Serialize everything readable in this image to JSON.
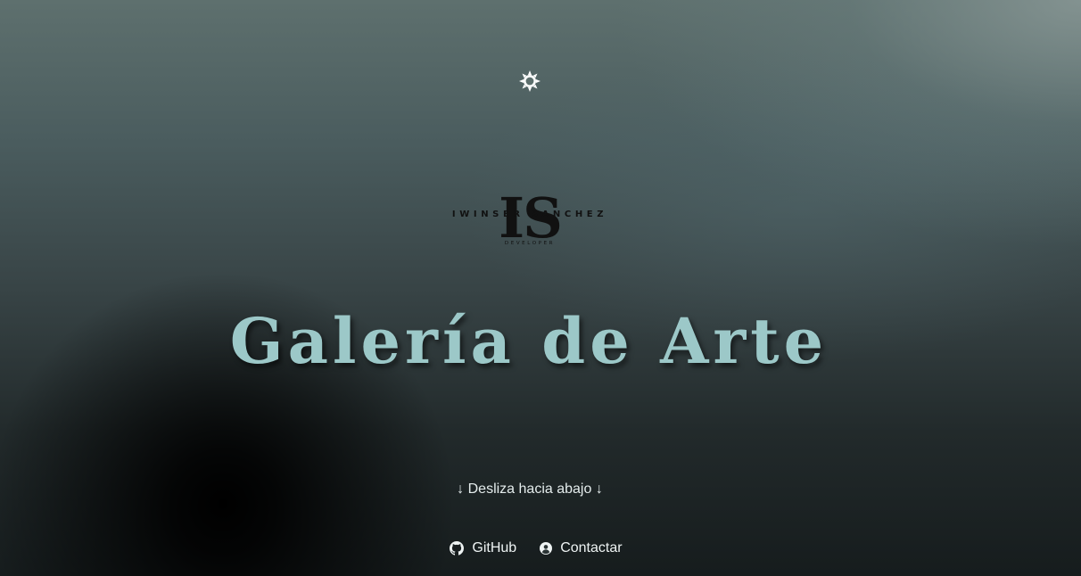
{
  "header": {
    "theme_toggle_icon": "sun-icon"
  },
  "logo": {
    "monogram": "IS",
    "name": "IWINSER SANCHEZ",
    "role": "DEVELOPER"
  },
  "hero": {
    "title": "Galería de Arte",
    "scroll_hint": "↓ Desliza hacia abajo ↓"
  },
  "footer": {
    "links": [
      {
        "label": "GitHub",
        "icon": "github-icon"
      },
      {
        "label": "Contactar",
        "icon": "user-circle-icon"
      }
    ]
  },
  "colors": {
    "title": "#9cc8c8",
    "text": "#eef3f3",
    "logo": "#111111"
  }
}
